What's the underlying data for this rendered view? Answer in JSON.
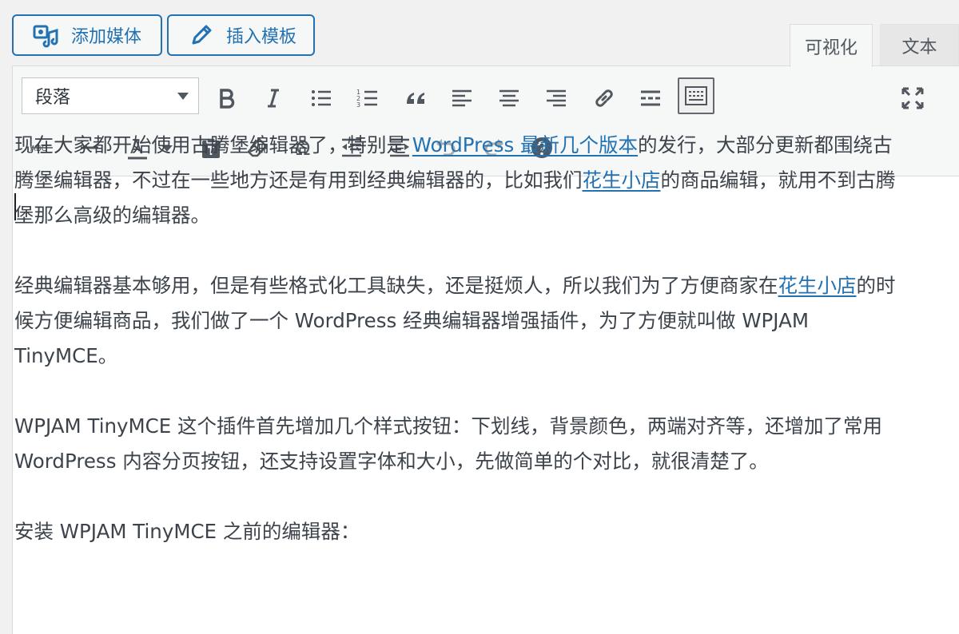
{
  "media_buttons": {
    "add_media": "添加媒体",
    "insert_template": "插入模板"
  },
  "tabs": {
    "visual": "可视化",
    "text": "文本"
  },
  "format_select": {
    "value": "段落"
  },
  "toolbar_icons": {
    "row1": [
      "bold-icon",
      "italic-icon",
      "bullet-list-icon",
      "numbered-list-icon",
      "blockquote-icon",
      "align-left-icon",
      "align-center-icon",
      "align-right-icon",
      "link-icon",
      "read-more-icon",
      "toolbar-toggle-icon",
      "fullscreen-icon"
    ],
    "row2": [
      "strikethrough-icon",
      "horizontal-line-icon",
      "text-color-icon",
      "paste-text-icon",
      "clear-formatting-icon",
      "special-character-icon",
      "outdent-icon",
      "indent-icon",
      "undo-icon",
      "redo-icon",
      "help-icon"
    ]
  },
  "content": {
    "p1_a": "现在大家都开始使用古腾堡编辑器了，特别是 ",
    "p1_link1": "WordPress 最新几个版本",
    "p1_b": "的发行，大部分更新都围绕古腾堡编辑器，不过在一些地方还是有用到经典编辑器的，比如我们",
    "p1_link2": "花生小店",
    "p1_c": "的商品编辑，就用不到古腾堡那么高级的编辑器。",
    "p2_a": "经典编辑器基本够用，但是有些格式化工具缺失，还是挺烦人，所以我们为了方便商家在",
    "p2_link": "花生小店",
    "p2_b": "的时候方便编辑商品，我们做了一个 WordPress 经典编辑器增强插件，为了方便就叫做 WPJAM TinyMCE。",
    "p3": "WPJAM TinyMCE 这个插件首先增加几个样式按钮：下划线，背景颜色，两端对齐等，还增加了常用 WordPress 内容分页按钮，还支持设置字体和大小，先做简单的个对比，就很清楚了。",
    "p4": "安装 WPJAM TinyMCE 之前的编辑器："
  },
  "colors": {
    "accent": "#2271b1",
    "toolbar_bg": "#f6f7f7",
    "icon": "#50575e"
  }
}
